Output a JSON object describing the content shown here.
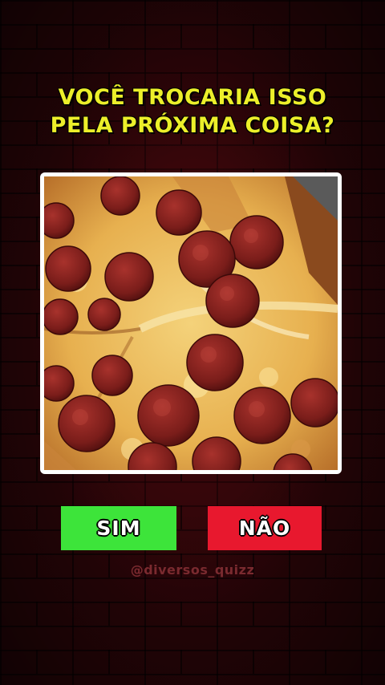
{
  "quiz": {
    "question_line1": "VOCÊ TROCARIA ISSO",
    "question_line2": "PELA PRÓXIMA COISA?",
    "image_subject": "pepperoni pizza"
  },
  "answers": {
    "yes_label": "SIM",
    "no_label": "NÃO"
  },
  "credit": {
    "handle": "@diversos_quizz"
  },
  "colors": {
    "title": "#ecef2a",
    "yes_button": "#3de43a",
    "no_button": "#e8182e",
    "background": "#2a0508"
  }
}
